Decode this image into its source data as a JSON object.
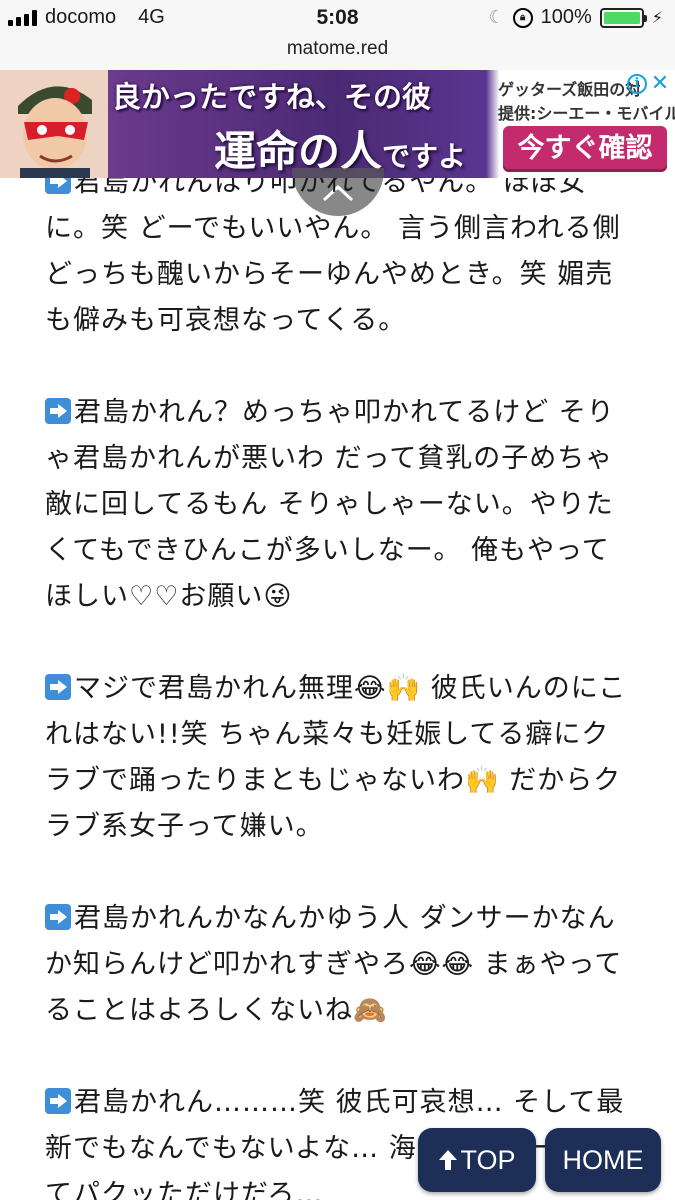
{
  "status_bar": {
    "carrier": "docomo",
    "network": "4G",
    "time": "5:08",
    "battery_percent": "100%",
    "battery_level": 1.0
  },
  "url_bar": {
    "domain": "matome.red"
  },
  "ad": {
    "headline": "良かったですね、その彼",
    "tagline_main": "運命の人",
    "tagline_tail": "ですよ",
    "sponsor_line1": "ゲッターズ飯田の対",
    "sponsor_line2": "提供:シーエー・モバイル",
    "cta_label": "今すぐ確認"
  },
  "comments": [
    {
      "text": "君島かれんはり叩かれてるやん。 ほぼ女に。笑 どーでもいいやん。 言う側言われる側どっちも醜いからそーゆんやめとき。笑 媚売も僻みも可哀想なってくる。"
    },
    {
      "text": "君島かれん？めっちゃ叩かれてるけど そりゃ君島かれんが悪いわ だって貧乳の子めちゃ敵に回してるもん そりゃしゃーない。やりたくてもできひんこが多いしなー。 俺もやってほしい♡♡お願い😜"
    },
    {
      "text": "マジで君島かれん無理😂🙌 彼氏いんのにこれはない!!笑 ちゃん菜々も妊娠してる癖にクラブで踊ったりまともじゃないわ🙌 だからクラブ系女子って嫌い。"
    },
    {
      "text": "君島かれんかなんかゆう人 ダンサーかなんか知らんけど叩かれすぎやろ😂😂 まぁやってることはよろしくないね🙈"
    },
    {
      "text": "君島かれん………笑 彼氏可哀想… そして最新でもなんでもないよな… 海外のツイート見てパクッただけだろ…"
    }
  ],
  "buttons": {
    "top_label": "TOP",
    "home_label": "HOME"
  },
  "icons": {
    "comment_marker": "right-arrow-icon",
    "collapse": "chevron-up-icon",
    "top": "up-arrow-icon"
  },
  "colors": {
    "button_bg": "#1d2f57",
    "arrow_icon": "#3f8fd8",
    "ad_cta": "#c42a6e",
    "battery": "#4cd964"
  }
}
